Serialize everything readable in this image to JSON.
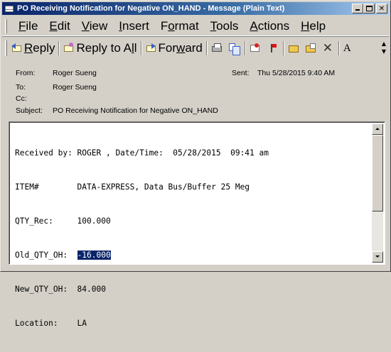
{
  "window": {
    "title": "PO Receiving Notification for Negative ON_HAND - Message (Plain Text)",
    "controls": [
      "minimize",
      "maximize",
      "close"
    ]
  },
  "menu": [
    {
      "label": "File",
      "ul": "F",
      "rest": "ile"
    },
    {
      "label": "Edit",
      "ul": "E",
      "rest": "dit"
    },
    {
      "label": "View",
      "ul": "V",
      "rest": "iew"
    },
    {
      "label": "Insert",
      "ul": "I",
      "rest": "nsert"
    },
    {
      "label": "Format",
      "pre": "F",
      "ul": "o",
      "rest": "rmat"
    },
    {
      "label": "Tools",
      "ul": "T",
      "rest": "ools"
    },
    {
      "label": "Actions",
      "ul": "A",
      "rest": "ctions"
    },
    {
      "label": "Help",
      "ul": "H",
      "rest": "elp"
    }
  ],
  "toolbar": {
    "reply": {
      "ul": "R",
      "rest": "eply"
    },
    "reply_all": {
      "pre": "Reply to A",
      "ul": "l",
      "rest": "l"
    },
    "forward": {
      "pre": "For",
      "ul": "w",
      "rest": "ard"
    },
    "icons": [
      "print-icon",
      "copy-icon",
      "mark-unread-icon",
      "flag-icon",
      "move-to-folder-icon",
      "file-folder-icon",
      "delete-icon",
      "font-size-icon"
    ],
    "font_glyph": "A"
  },
  "header": {
    "from_label": "From:",
    "from": "Roger Sueng",
    "to_label": "To:",
    "to": "Roger Sueng",
    "cc_label": "Cc:",
    "cc": "",
    "subject_label": "Subject:",
    "subject": "PO Receiving Notification for Negative ON_HAND",
    "sent_label": "Sent:",
    "sent": "Thu 5/28/2015 9:40 AM"
  },
  "body": {
    "line1": "Received by: ROGER , Date/Time:  05/28/2015  09:41 am",
    "line2": "ITEM#        DATA-EXPRESS, Data Bus/Buffer 25 Meg",
    "line3": "QTY_Rec:     100.000",
    "line4_prefix": "Old_QTY_OH:  ",
    "line4_selected": "-16.000",
    "line5": "New_QTY_OH:  84.000",
    "line6": "Location:    LA"
  }
}
